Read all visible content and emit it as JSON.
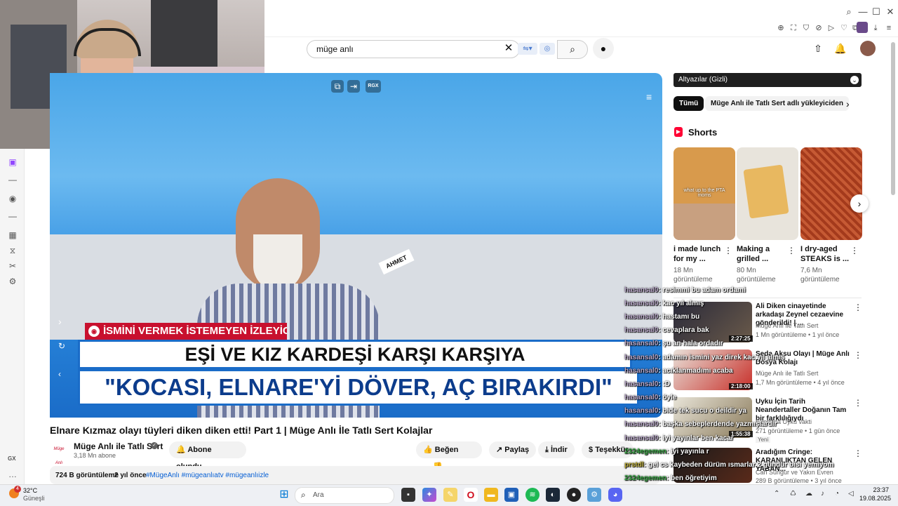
{
  "browser": {
    "window_controls": [
      "⌕",
      "—",
      "☐",
      "✕"
    ],
    "extension_icons": [
      "pin-icon",
      "screenshot-icon",
      "shield-icon",
      "adblock-icon",
      "play-icon",
      "heart-icon",
      "puzzle-icon",
      "menu-icon"
    ]
  },
  "youtube": {
    "search_value": "müge anlı",
    "clear_icon": "✕",
    "search_icon": "⌕",
    "mic_icon": "🎤"
  },
  "video": {
    "overlay_icons": [
      "⧉",
      "⇥",
      "RGX"
    ],
    "lower_third_label": "İSMİNİ VERMEK İSTEMEYEN İZLEYİCİ",
    "headline_line1": "EŞİ VE KIZ KARDEŞİ KARŞI KARŞIYA",
    "headline_line2": "\"KOCASI, ELNARE'Yİ DÖVER, AÇ BIRAKIRDI\"",
    "name_tag": "AHMET",
    "title": "Elnare Kızmaz olayı tüyleri diken diken etti! Part 1 | Müge Anlı İle Tatlı Sert Kolajlar",
    "channel_name": "Müge Anlı ile Tatlı Sert",
    "channel_logo_text": "Müge Anlı",
    "subscribers": "3,18 Mn abone",
    "subscribed_label": "Abone olundu",
    "like_label": "Beğen",
    "share_label": "Paylaş",
    "download_label": "İndir",
    "thanks_label": "Teşekkür",
    "views": "724 B görüntüleme",
    "age": "2 yıl önce",
    "hashtags": "#MügeAnlı #mügeanlıatv #mügeanlıizle"
  },
  "sidebar": {
    "subtitles": "Altyazılar (Gizli)",
    "chips": [
      "Tümü",
      "Müge Anlı ile Tatlı Sert adlı yükleyiciden"
    ],
    "shorts_title": "Shorts",
    "shorts": [
      {
        "title": "i made lunch for my ...",
        "views": "18 Mn",
        "views_label": "görüntüleme",
        "thumb_text": "what up to the PTA moms",
        "color": "#d89a4c"
      },
      {
        "title": "Making a grilled ...",
        "views": "80 Mn",
        "views_label": "görüntüleme",
        "thumb_text": "",
        "color": "#e8b860"
      },
      {
        "title": "I dry-aged STEAKS is ...",
        "views": "7,6 Mn",
        "views_label": "görüntüleme",
        "thumb_text": "",
        "color": "#b84a2a"
      }
    ],
    "videos": [
      {
        "title": "Ali Diken cinayetinde arkadaşı Zeynel cezaevine gönderildi! | ...",
        "channel": "Müge Anlı ile Tatlı Sert",
        "meta": "1 Mn görüntüleme • 1 yıl önce",
        "duration": "2:27:25",
        "extra": ""
      },
      {
        "title": "Seda Aksu Olayı  | Müge Anlı Dosya Kolajı",
        "channel": "Müge Anlı ile Tatlı Sert",
        "meta": "1,7 Mn görüntüleme • 4 yıl önce",
        "duration": "2:18:00",
        "extra": ""
      },
      {
        "title": "Uyku İçin Tarih  Neandertaller Doğanın Tam bir farklılığıydı",
        "channel": "Euphoria Uyku vakti",
        "meta": "271 görüntüleme • 1 gün önce",
        "duration": "1:55:38",
        "extra": "Yeni"
      },
      {
        "title": "Aradığım Cringe: KARANLIKTAN GELEN YABAN...",
        "channel": "Can Sungur ve Yakın Evren",
        "meta": "289 B görüntüleme • 3 yıl önce",
        "duration": "",
        "extra": ""
      }
    ]
  },
  "chat": [
    {
      "user": "hasansal0",
      "msg": "resimmi bu adam ordami"
    },
    {
      "user": "hasansal0",
      "msg": "kac yıl almış"
    },
    {
      "user": "hasansal0",
      "msg": "hastamı bu"
    },
    {
      "user": "hasansal0",
      "msg": "cevaplara bak"
    },
    {
      "user": "hasansal0",
      "msg": "şu an hala ordadır"
    },
    {
      "user": "hasansal0",
      "msg": "adamın ismini yaz direk kac yıl almış"
    },
    {
      "user": "hasansal0",
      "msg": "acıklanmadımı acaba"
    },
    {
      "user": "hasansal0",
      "msg": ":D"
    },
    {
      "user": "hasansal0",
      "msg": "öyle"
    },
    {
      "user": "hasansal0",
      "msg": "bide tek sucu o deildir ya"
    },
    {
      "user": "hasansal0",
      "msg": "başka sebeplerdende yazmışlardır"
    },
    {
      "user": "hasansal0",
      "msg": "iyi yayınlar ben kacar"
    },
    {
      "user": "2324egemen",
      "msg": "iyi yayınla r"
    },
    {
      "user": "prstdl",
      "msg": "gel cs kaybeden dürüm ısmarlar 2 gündür bisi yemiyom"
    },
    {
      "user": "2324egemen",
      "msg": "ben öğretiyim"
    }
  ],
  "taskbar": {
    "weather_temp": "32°C",
    "weather_desc": "Güneşli",
    "weather_badge": "4",
    "search_placeholder": "Ara",
    "time": "23:37",
    "date": "19.08.2025",
    "gx_label": "GX"
  },
  "colors": {
    "accent": "#cc0000",
    "twitch": "#9146ff",
    "video_blue": "#2d8de0",
    "banner_red": "#c8102e"
  }
}
